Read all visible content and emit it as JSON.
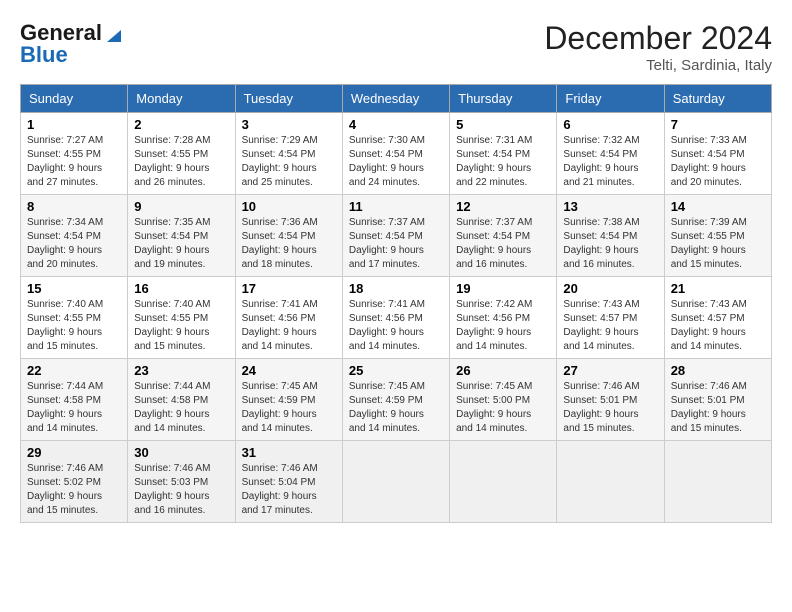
{
  "header": {
    "logo_general": "General",
    "logo_blue": "Blue",
    "month_title": "December 2024",
    "location": "Telti, Sardinia, Italy"
  },
  "weekdays": [
    "Sunday",
    "Monday",
    "Tuesday",
    "Wednesday",
    "Thursday",
    "Friday",
    "Saturday"
  ],
  "weeks": [
    [
      {
        "day": "1",
        "sunrise": "7:27 AM",
        "sunset": "4:55 PM",
        "daylight": "9 hours and 27 minutes."
      },
      {
        "day": "2",
        "sunrise": "7:28 AM",
        "sunset": "4:55 PM",
        "daylight": "9 hours and 26 minutes."
      },
      {
        "day": "3",
        "sunrise": "7:29 AM",
        "sunset": "4:54 PM",
        "daylight": "9 hours and 25 minutes."
      },
      {
        "day": "4",
        "sunrise": "7:30 AM",
        "sunset": "4:54 PM",
        "daylight": "9 hours and 24 minutes."
      },
      {
        "day": "5",
        "sunrise": "7:31 AM",
        "sunset": "4:54 PM",
        "daylight": "9 hours and 22 minutes."
      },
      {
        "day": "6",
        "sunrise": "7:32 AM",
        "sunset": "4:54 PM",
        "daylight": "9 hours and 21 minutes."
      },
      {
        "day": "7",
        "sunrise": "7:33 AM",
        "sunset": "4:54 PM",
        "daylight": "9 hours and 20 minutes."
      }
    ],
    [
      {
        "day": "8",
        "sunrise": "7:34 AM",
        "sunset": "4:54 PM",
        "daylight": "9 hours and 20 minutes."
      },
      {
        "day": "9",
        "sunrise": "7:35 AM",
        "sunset": "4:54 PM",
        "daylight": "9 hours and 19 minutes."
      },
      {
        "day": "10",
        "sunrise": "7:36 AM",
        "sunset": "4:54 PM",
        "daylight": "9 hours and 18 minutes."
      },
      {
        "day": "11",
        "sunrise": "7:37 AM",
        "sunset": "4:54 PM",
        "daylight": "9 hours and 17 minutes."
      },
      {
        "day": "12",
        "sunrise": "7:37 AM",
        "sunset": "4:54 PM",
        "daylight": "9 hours and 16 minutes."
      },
      {
        "day": "13",
        "sunrise": "7:38 AM",
        "sunset": "4:54 PM",
        "daylight": "9 hours and 16 minutes."
      },
      {
        "day": "14",
        "sunrise": "7:39 AM",
        "sunset": "4:55 PM",
        "daylight": "9 hours and 15 minutes."
      }
    ],
    [
      {
        "day": "15",
        "sunrise": "7:40 AM",
        "sunset": "4:55 PM",
        "daylight": "9 hours and 15 minutes."
      },
      {
        "day": "16",
        "sunrise": "7:40 AM",
        "sunset": "4:55 PM",
        "daylight": "9 hours and 15 minutes."
      },
      {
        "day": "17",
        "sunrise": "7:41 AM",
        "sunset": "4:56 PM",
        "daylight": "9 hours and 14 minutes."
      },
      {
        "day": "18",
        "sunrise": "7:41 AM",
        "sunset": "4:56 PM",
        "daylight": "9 hours and 14 minutes."
      },
      {
        "day": "19",
        "sunrise": "7:42 AM",
        "sunset": "4:56 PM",
        "daylight": "9 hours and 14 minutes."
      },
      {
        "day": "20",
        "sunrise": "7:43 AM",
        "sunset": "4:57 PM",
        "daylight": "9 hours and 14 minutes."
      },
      {
        "day": "21",
        "sunrise": "7:43 AM",
        "sunset": "4:57 PM",
        "daylight": "9 hours and 14 minutes."
      }
    ],
    [
      {
        "day": "22",
        "sunrise": "7:44 AM",
        "sunset": "4:58 PM",
        "daylight": "9 hours and 14 minutes."
      },
      {
        "day": "23",
        "sunrise": "7:44 AM",
        "sunset": "4:58 PM",
        "daylight": "9 hours and 14 minutes."
      },
      {
        "day": "24",
        "sunrise": "7:45 AM",
        "sunset": "4:59 PM",
        "daylight": "9 hours and 14 minutes."
      },
      {
        "day": "25",
        "sunrise": "7:45 AM",
        "sunset": "4:59 PM",
        "daylight": "9 hours and 14 minutes."
      },
      {
        "day": "26",
        "sunrise": "7:45 AM",
        "sunset": "5:00 PM",
        "daylight": "9 hours and 14 minutes."
      },
      {
        "day": "27",
        "sunrise": "7:46 AM",
        "sunset": "5:01 PM",
        "daylight": "9 hours and 15 minutes."
      },
      {
        "day": "28",
        "sunrise": "7:46 AM",
        "sunset": "5:01 PM",
        "daylight": "9 hours and 15 minutes."
      }
    ],
    [
      {
        "day": "29",
        "sunrise": "7:46 AM",
        "sunset": "5:02 PM",
        "daylight": "9 hours and 15 minutes."
      },
      {
        "day": "30",
        "sunrise": "7:46 AM",
        "sunset": "5:03 PM",
        "daylight": "9 hours and 16 minutes."
      },
      {
        "day": "31",
        "sunrise": "7:46 AM",
        "sunset": "5:04 PM",
        "daylight": "9 hours and 17 minutes."
      },
      null,
      null,
      null,
      null
    ]
  ],
  "labels": {
    "sunrise": "Sunrise:",
    "sunset": "Sunset:",
    "daylight": "Daylight:"
  }
}
